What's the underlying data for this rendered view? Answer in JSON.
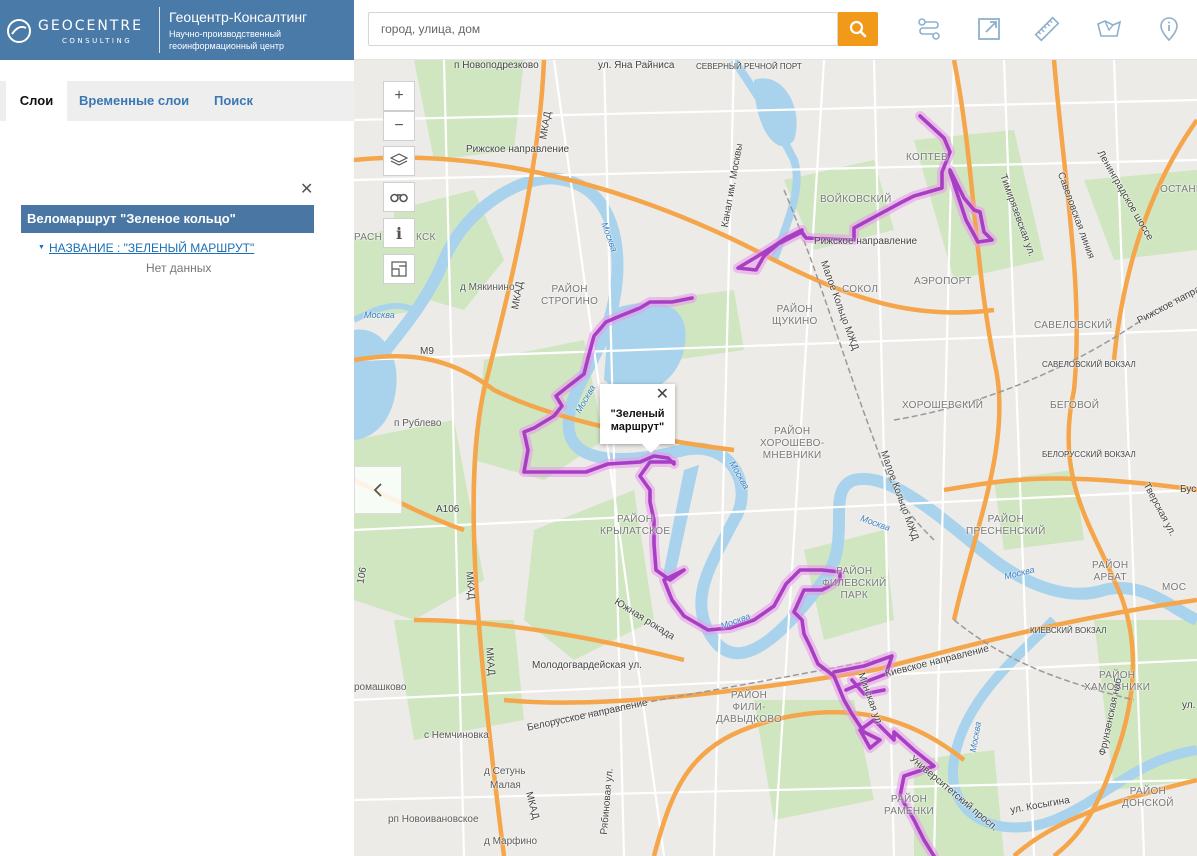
{
  "header": {
    "logo_name": "GEOCENTRE",
    "logo_sub": "CONSULTING",
    "company": "Геоцентр-Консалтинг",
    "tagline_1": "Научно-производственный",
    "tagline_2": "геоинформационный центр"
  },
  "search": {
    "placeholder": "город, улица, дом",
    "value": ""
  },
  "toolbar": {
    "icons": [
      "route-icon",
      "external-link-icon",
      "ruler-icon",
      "area-measure-icon",
      "info-icon"
    ],
    "search_button_color": "#f19a1a"
  },
  "tabs": [
    {
      "label": "Слои",
      "active": true
    },
    {
      "label": "Временные слои",
      "active": false
    },
    {
      "label": "Поиск",
      "active": false
    }
  ],
  "layer": {
    "title": "Веломаршрут \"Зеленое кольцо\"",
    "feature_link": "НАЗВАНИЕ : \"ЗЕЛЕНЫЙ МАРШРУТ\"",
    "no_data": "Нет данных"
  },
  "map_controls": {
    "zoom_in": "+",
    "zoom_out": "−",
    "info": "i"
  },
  "popup": {
    "line1": "\"Зеленый",
    "line2": "маршрут\""
  },
  "colors": {
    "header": "#4a7aa8",
    "route": "#c646e0",
    "road_major": "#f5a54a",
    "water": "#a9d3ec",
    "park": "#cfe6c0"
  },
  "map_labels": {
    "districts": {
      "koptevo": "КОПТЕВ",
      "voykovsky": "ВОЙКОВСКИЙ",
      "aeroport": "АЭРОПОРТ",
      "sokol": "СОКОЛ",
      "shchukino1": "РАЙОН",
      "shchukino2": "ЩУКИНО",
      "strogino1": "РАЙОН",
      "strogino2": "СТРОГИНО",
      "savelovsky": "САВЕЛОВСКИЙ",
      "horoshevsky": "ХОРОШЕВСКИЙ",
      "begovoy": "БЕГОВОЙ",
      "hm1": "РАЙОН",
      "hm2": "ХОРОШЕВО-",
      "hm3": "МНЕВНИКИ",
      "kr1": "РАЙОН",
      "kr2": "КРЫЛАТСКОЕ",
      "pr1": "РАЙОН",
      "pr2": "ПРЕСНЕНСКИЙ",
      "fp1": "РАЙОН",
      "fp2": "ФИЛЕВСКИЙ",
      "fp3": "ПАРК",
      "ar1": "РАЙОН",
      "ar2": "АРБАТ",
      "fd1": "РАЙОН",
      "fd2": "ФИЛИ-",
      "fd3": "ДАВЫДКОВО",
      "kh1": "РАЙОН",
      "kh2": "ХАМОВНИКИ",
      "rm1": "РАЙОН",
      "rm2": "РАМЕНКИ",
      "do1": "РАЙОН",
      "do2": "ДОНСКОЙ",
      "ostank": "ОСТАНК",
      "mos": "МОС",
      "ras": "РАСН",
      "ks": "КСК"
    },
    "places": {
      "myakinino": "д Мякинино",
      "rublevo": "п Рублево",
      "nemchinovka": "с Немчиновка",
      "setun": "д Сетунь",
      "malaya": "Малая",
      "novoivanovskoe": "рп Новоивановское",
      "marfino": "д Марфино",
      "ramashkovo": "ромашково"
    },
    "roads": {
      "novoshod": "п Новоподрезково",
      "yana": "ул. Яна Райниса",
      "sev_port": "СЕВЕРНЫЙ РЕЧНОЙ ПОРТ",
      "rizh1": "Рижское направление",
      "rizh2": "Рижское направление",
      "rizh3": "Рижское направление",
      "mkad1": "МКАД",
      "mkad2": "МКАД",
      "mkad3": "МКАД",
      "mkad4": "МКАД",
      "mkad5": "МКАД",
      "m9": "M9",
      "a106": "A106",
      "n106": "106",
      "yuzh": "Южная рокада",
      "molod": "Молодогвардейская ул.",
      "belor": "Белорусское направление",
      "kiev": "Киевское направление",
      "mkzd1": "Малое Кольцо МЖД",
      "mkzd2": "Малое Кольцо МЖД",
      "timir": "Тимирязевская ул.",
      "savelovsk": "Савеловская линия",
      "leningr": "Ленинградское шоссе",
      "tversk": "Тверская ул.",
      "frunz": "Фрунзенская наб.",
      "kosygina": "ул. Косыгина",
      "univer": "Университетский просп.",
      "ryabin": "Рябиновая ул.",
      "kievsk_station": "КИЕВСКИЙ ВОКЗАЛ",
      "belorussk_station": "БЕЛОРУССКИЙ ВОКЗАЛ",
      "savelovsk_station": "САВЕЛОВСКИЙ ВОКЗАЛ",
      "kanal": "Канал им. Москвы",
      "bus": "Бус",
      "ulsh": "ул.",
      "minsk": "Минская ул."
    },
    "water": {
      "m1": "Москва",
      "m2": "Москва",
      "m3": "Москва",
      "m4": "Москва",
      "m5": "Москва",
      "m6": "Москва",
      "m7": "Москва",
      "m8": "Москва"
    }
  }
}
